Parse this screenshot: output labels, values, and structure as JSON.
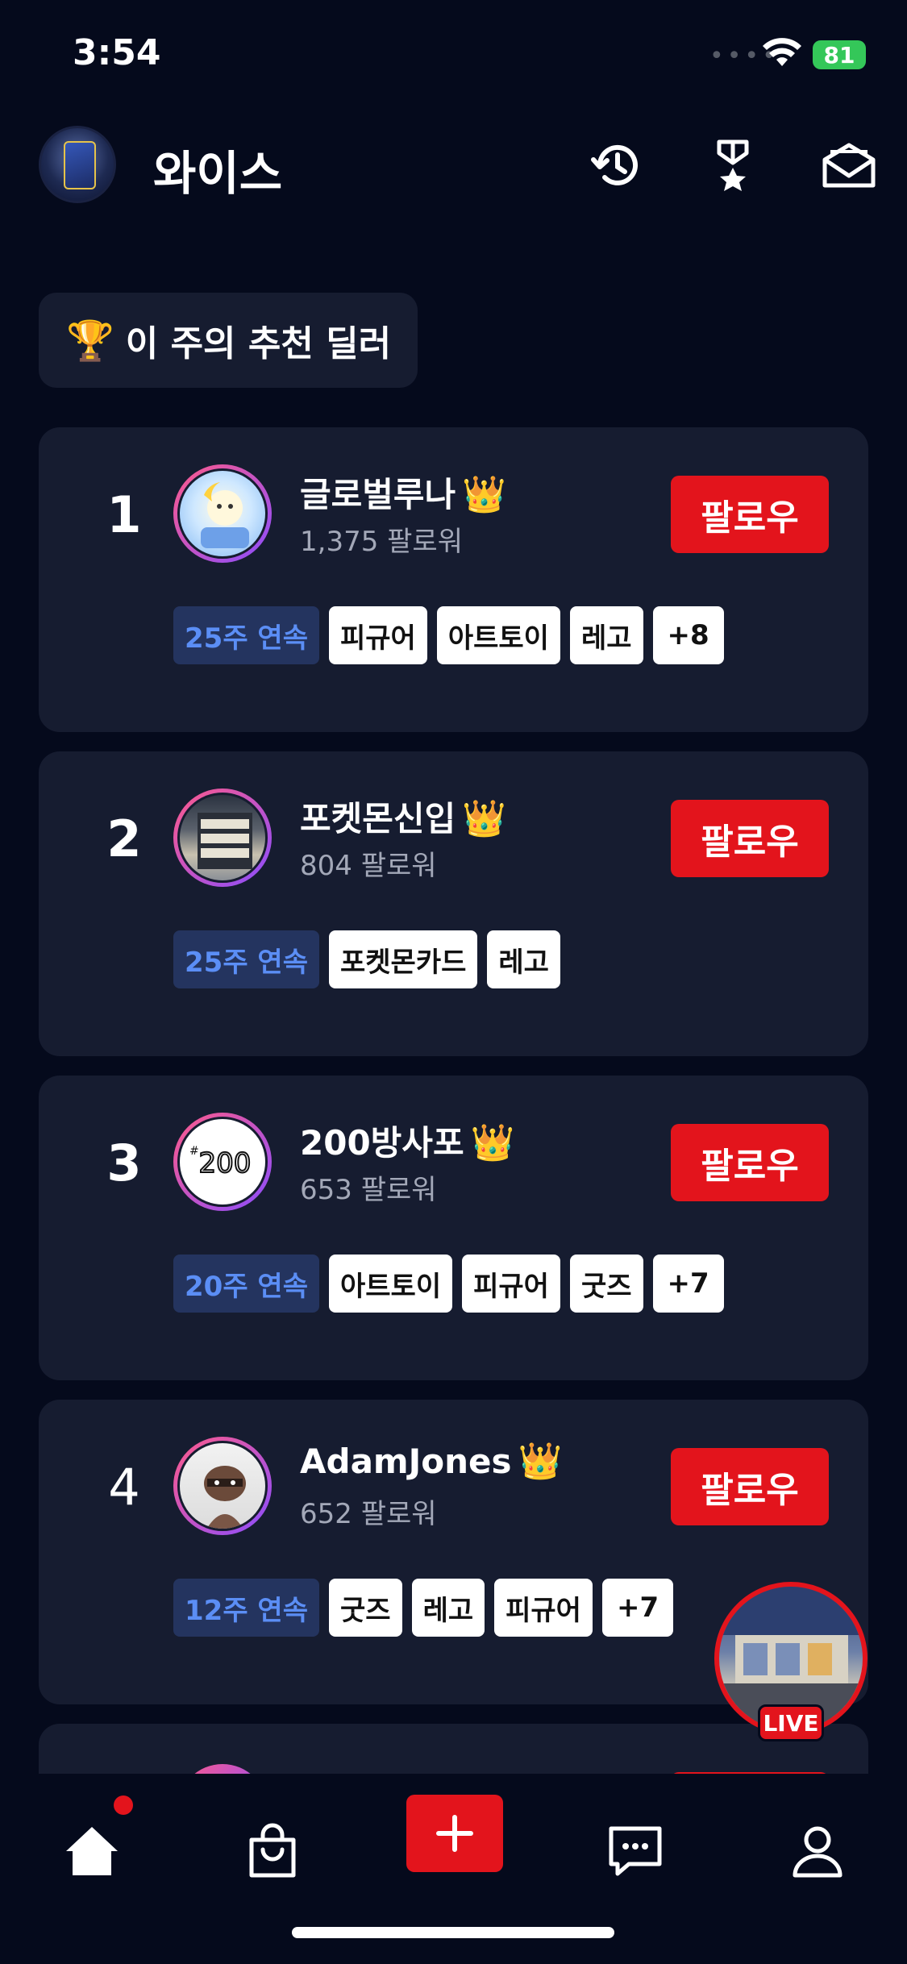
{
  "status_bar": {
    "time": "3:54",
    "battery": "81"
  },
  "header": {
    "title": "와이스"
  },
  "section": {
    "trophy": "🏆",
    "title": "이 주의 추천 딜러"
  },
  "dealers": [
    {
      "rank": "1",
      "name": "글로벌루나",
      "crown": "👑",
      "followers": "1,375 팔로워",
      "follow_label": "팔로우",
      "streak": "25주 연속",
      "tags": [
        "피규어",
        "아트토이",
        "레고"
      ],
      "more": "+8"
    },
    {
      "rank": "2",
      "name": "포켓몬신입",
      "crown": "👑",
      "followers": "804 팔로워",
      "follow_label": "팔로우",
      "streak": "25주 연속",
      "tags": [
        "포켓몬카드",
        "레고"
      ],
      "more": ""
    },
    {
      "rank": "3",
      "name": "200방사포",
      "crown": "👑",
      "followers": "653 팔로워",
      "follow_label": "팔로우",
      "streak": "20주 연속",
      "tags": [
        "아트토이",
        "피규어",
        "굿즈"
      ],
      "more": "+7"
    },
    {
      "rank": "4",
      "name": "AdamJones",
      "crown": "👑",
      "followers": "652 팔로워",
      "follow_label": "팔로우",
      "streak": "12주 연속",
      "tags": [
        "굿즈",
        "레고",
        "피규어"
      ],
      "more": "+7"
    }
  ],
  "live": {
    "label": "LIVE"
  },
  "nav": {
    "items": [
      "home-icon",
      "shopping-bag-icon",
      "plus-icon",
      "chat-icon",
      "profile-icon"
    ]
  },
  "colors": {
    "accent": "#e3141c",
    "background": "#050a1c",
    "card": "#161c30",
    "streak_text": "#5b8ef5"
  }
}
